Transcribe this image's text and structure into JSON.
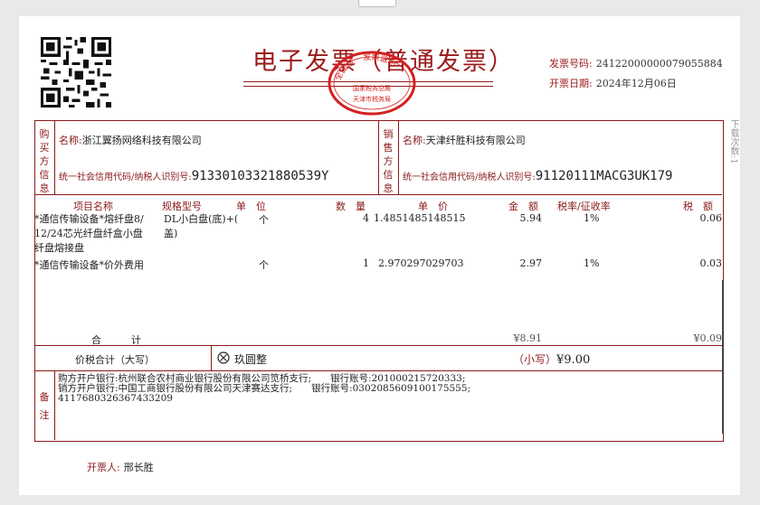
{
  "invoice": {
    "title": "电子发票（普通发票）",
    "number_label": "发票号码:",
    "number": "24122000000079055884",
    "date_label": "开票日期:",
    "date": "2024年12月06日",
    "seal_top": "全国统一发票监制",
    "seal_mid": "国家税务总局",
    "seal_bottom": "天津市税务局"
  },
  "buyer": {
    "side_label": [
      "购",
      "买",
      "方",
      "信",
      "息"
    ],
    "name_label": "名称:",
    "name": "浙江翼扬网络科技有限公司",
    "tax_label": "统一社会信用代码/纳税人识别号:",
    "tax_id": "91330103321880539Y"
  },
  "seller": {
    "side_label": [
      "销",
      "售",
      "方",
      "信",
      "息"
    ],
    "name_label": "名称:",
    "name": "天津纤胜科技有限公司",
    "tax_label": "统一社会信用代码/纳税人识别号:",
    "tax_id": "91120111MACG3UK179"
  },
  "table": {
    "headers": [
      "项目名称",
      "规格型号",
      "单　位",
      "数　量",
      "单　价",
      "金　额",
      "税率/征收率",
      "税　额"
    ],
    "rows": [
      {
        "name": [
          "*通信传输设备*熔纤盘8/",
          "12/24芯光纤盘纤盒小盘",
          "纤盘熔接盘"
        ],
        "spec": [
          "DL小白盘(底)+(",
          "盖)"
        ],
        "unit": "个",
        "qty": "4",
        "price": "1.4851485148515",
        "amount": "5.94",
        "rate": "1%",
        "tax": "0.06"
      },
      {
        "name": [
          "*通信传输设备*价外费用"
        ],
        "spec": [],
        "unit": "个",
        "qty": "1",
        "price": "2.970297029703",
        "amount": "2.97",
        "rate": "1%",
        "tax": "0.03"
      }
    ],
    "total_label": "合　　　计",
    "total_amount": "¥8.91",
    "total_tax": "¥0.09"
  },
  "sum": {
    "label": "价税合计（大写）",
    "words": "玖圆整",
    "small_label": "（小写）",
    "small": "¥9.00"
  },
  "remarks": {
    "side_label": [
      "备",
      "注"
    ],
    "lines": [
      "购方开户银行:杭州联合农村商业银行股份有限公司笕桥支行;　　银行账号:201000215720333;",
      "销方开户银行:中国工商银行股份有限公司天津赛达支行;　　银行账号:0302085609100175555;",
      "4117680326367433209"
    ]
  },
  "issuer": {
    "label": "开票人:",
    "name": "邢长胜"
  },
  "side_note": "下载次数:1"
}
